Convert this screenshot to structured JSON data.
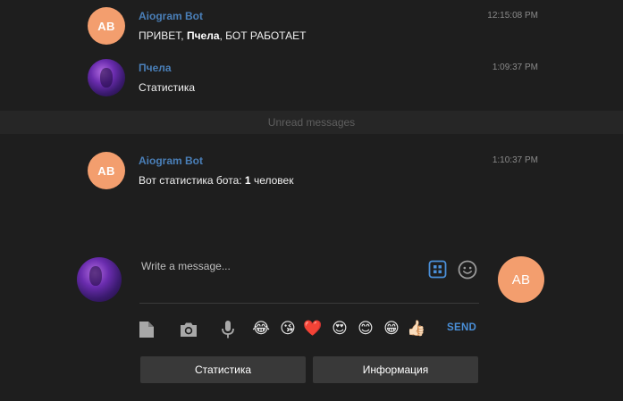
{
  "messages": [
    {
      "avatar_initials": "AB",
      "sender": "Aiogram Bot",
      "time": "12:15:08 PM",
      "text_parts": [
        "ПРИВЕТ, ",
        "Пчела",
        ", БОТ РАБОТАЕТ"
      ]
    },
    {
      "avatar_initials": "",
      "sender": "Пчела",
      "time": "1:09:37 PM",
      "text": "Статистика"
    },
    {
      "avatar_initials": "AB",
      "sender": "Aiogram Bot",
      "time": "1:10:37 PM",
      "text_parts": [
        "Вот статистика бота: ",
        "1",
        " человек"
      ]
    }
  ],
  "divider": {
    "unread_label": "Unread messages"
  },
  "composer": {
    "placeholder": "Write a message...",
    "send_avatar_initials": "AB",
    "send_label": "SEND",
    "emojis": [
      "😂",
      "😘",
      "❤️",
      "😍",
      "😊",
      "😁",
      "👍🏻"
    ]
  },
  "keyboard": {
    "buttons": [
      "Статистика",
      "Информация"
    ]
  },
  "colors": {
    "background": "#1e1e1e",
    "accent": "#4a8fd8",
    "bot_avatar": "#f39e6e",
    "sender_name": "#4a7fb8"
  }
}
